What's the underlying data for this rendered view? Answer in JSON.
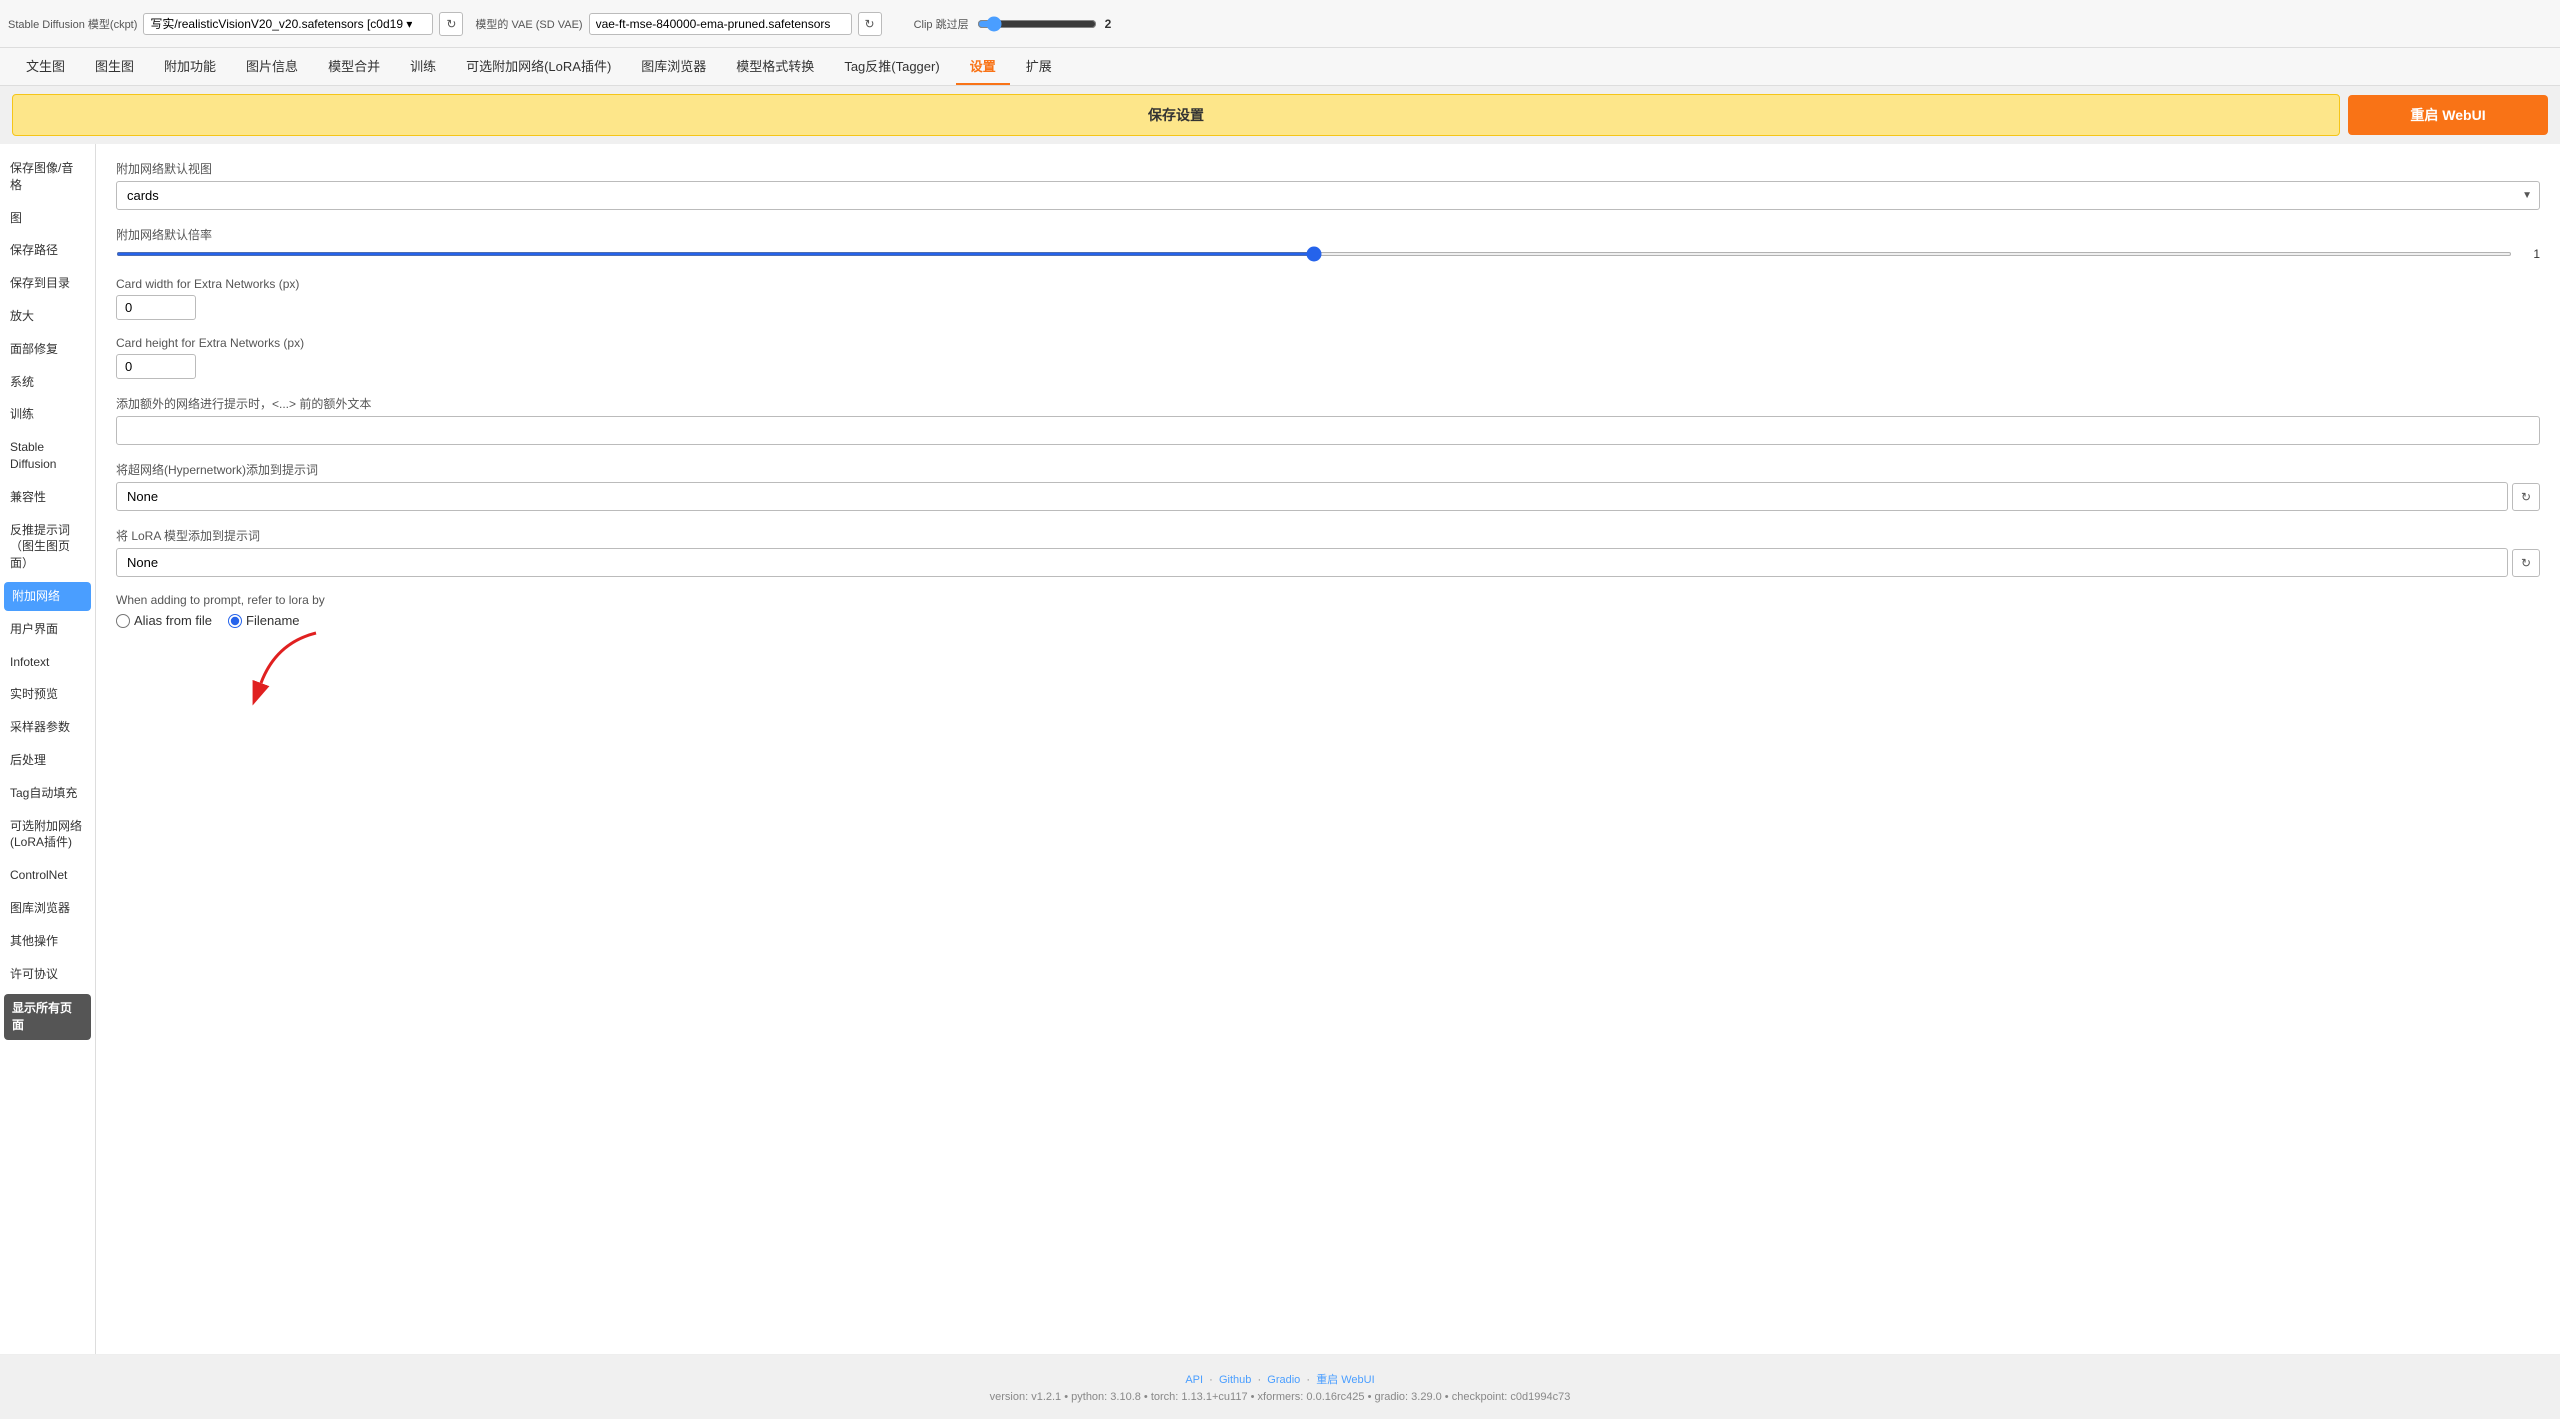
{
  "window_title": "Stable Diffusion 模型(ckpt)",
  "top_bar": {
    "model_label": "写实/realisticVisionV20_v20.safetensors [c0d19 ▾",
    "vae_label": "模型的 VAE (SD VAE)",
    "vae_value": "vae-ft-mse-840000-ema-pruned.safetensors",
    "clip_label": "Clip 跳过层",
    "clip_value": "2"
  },
  "nav": {
    "items": [
      {
        "label": "文生图",
        "active": false
      },
      {
        "label": "图生图",
        "active": false
      },
      {
        "label": "附加功能",
        "active": false
      },
      {
        "label": "图片信息",
        "active": false
      },
      {
        "label": "模型合并",
        "active": false
      },
      {
        "label": "训练",
        "active": false
      },
      {
        "label": "可选附加网络(LoRA插件)",
        "active": false
      },
      {
        "label": "图库浏览器",
        "active": false
      },
      {
        "label": "模型格式转换",
        "active": false
      },
      {
        "label": "Tag反推(Tagger)",
        "active": false
      },
      {
        "label": "设置",
        "active": true
      },
      {
        "label": "扩展",
        "active": false
      }
    ]
  },
  "actions": {
    "save_label": "保存设置",
    "restart_label": "重启 WebUI"
  },
  "sidebar": {
    "items": [
      {
        "label": "保存图像/音格",
        "active": false
      },
      {
        "label": "图",
        "active": false
      },
      {
        "label": "保存路径",
        "active": false
      },
      {
        "label": "保存到目录",
        "active": false
      },
      {
        "label": "放大",
        "active": false
      },
      {
        "label": "面部修复",
        "active": false
      },
      {
        "label": "系统",
        "active": false
      },
      {
        "label": "训练",
        "active": false
      },
      {
        "label": "Stable Diffusion",
        "active": false
      },
      {
        "label": "兼容性",
        "active": false
      },
      {
        "label": "反推提示词（图生图页面）",
        "active": false
      },
      {
        "label": "附加网络",
        "active": true
      },
      {
        "label": "用户界面",
        "active": false
      },
      {
        "label": "Infotext",
        "active": false
      },
      {
        "label": "实时预览",
        "active": false
      },
      {
        "label": "采样器参数",
        "active": false
      },
      {
        "label": "后处理",
        "active": false
      },
      {
        "label": "Tag自动填充",
        "active": false
      },
      {
        "label": "可选附加网络(LoRA插件)",
        "active": false
      },
      {
        "label": "ControlNet",
        "active": false
      },
      {
        "label": "图库浏览器",
        "active": false
      },
      {
        "label": "其他操作",
        "active": false
      },
      {
        "label": "许可协议",
        "active": false
      },
      {
        "label": "显示所有页面",
        "active": false,
        "highlight": true
      }
    ]
  },
  "settings": {
    "extra_networks_default_view_label": "附加网络默认视图",
    "extra_networks_default_view_value": "cards",
    "extra_networks_default_multiplier_label": "附加网络默认倍率",
    "extra_networks_default_multiplier_value": 1,
    "card_width_label": "Card width for Extra Networks (px)",
    "card_width_value": "0",
    "card_height_label": "Card height for Extra Networks (px)",
    "card_height_value": "0",
    "extra_text_label": "添加额外的网络进行提示时，<...> 前的额外文本",
    "extra_text_value": "",
    "hypernetwork_label": "将超网络(Hypernetwork)添加到提示词",
    "hypernetwork_value": "None",
    "lora_label": "将 LoRA 模型添加到提示词",
    "lora_value": "None",
    "lora_refer_label": "When adding to prompt, refer to lora by",
    "alias_from_file_label": "Alias from file",
    "filename_label": "Filename",
    "filename_selected": true
  },
  "footer": {
    "links": [
      "API",
      "Github",
      "Gradio",
      "重启 WebUI"
    ],
    "version_text": "version: v1.2.1  •  python: 3.10.8  •  torch: 1.13.1+cu117  •  xformers: 0.0.16rc425  •  gradio: 3.29.0  •  checkpoint: c0d1994c73"
  }
}
